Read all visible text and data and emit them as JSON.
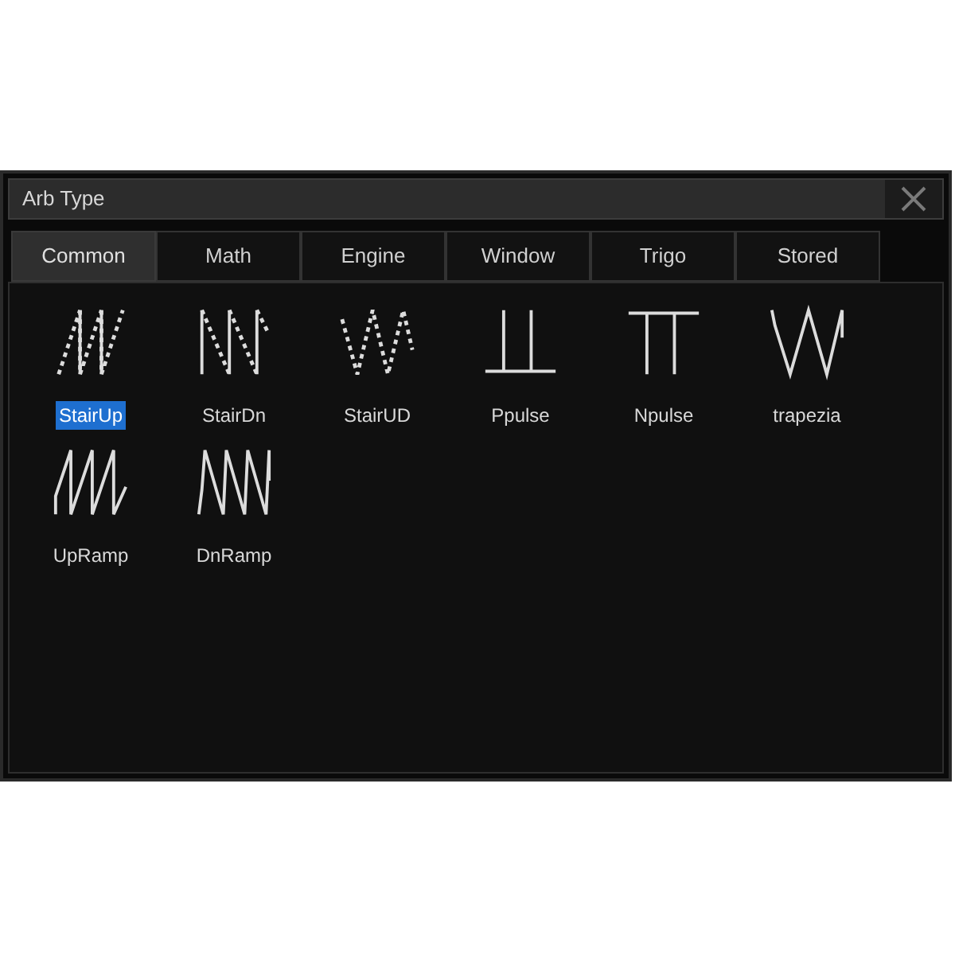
{
  "dialog": {
    "title": "Arb Type"
  },
  "tabs": [
    {
      "label": "Common",
      "selected": true
    },
    {
      "label": "Math",
      "selected": false
    },
    {
      "label": "Engine",
      "selected": false
    },
    {
      "label": "Window",
      "selected": false
    },
    {
      "label": "Trigo",
      "selected": false
    },
    {
      "label": "Stored",
      "selected": false
    }
  ],
  "waveforms": [
    {
      "label": "StairUp",
      "kind": "stairup",
      "selected": true
    },
    {
      "label": "StairDn",
      "kind": "stairdn",
      "selected": false
    },
    {
      "label": "StairUD",
      "kind": "stairud",
      "selected": false
    },
    {
      "label": "Ppulse",
      "kind": "ppulse",
      "selected": false
    },
    {
      "label": "Npulse",
      "kind": "npulse",
      "selected": false
    },
    {
      "label": "trapezia",
      "kind": "trapezia",
      "selected": false
    },
    {
      "label": "UpRamp",
      "kind": "upramp",
      "selected": false
    },
    {
      "label": "DnRamp",
      "kind": "dnramp",
      "selected": false
    }
  ]
}
